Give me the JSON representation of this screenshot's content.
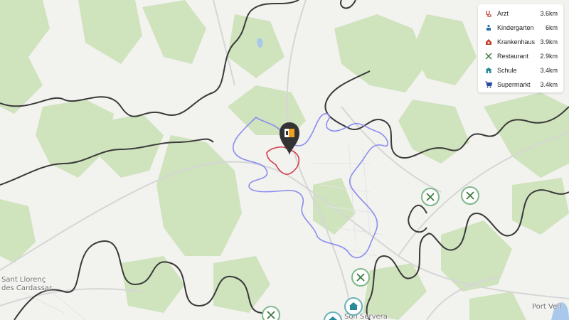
{
  "map": {
    "places": [
      {
        "name": "Sant Llorenç\ndes Cardassar"
      },
      {
        "name": "Son Servera"
      },
      {
        "name": "Port Vell"
      }
    ]
  },
  "legend": {
    "items": [
      {
        "label": "Arzt",
        "distance": "3.6km",
        "icon": "stethoscope-icon",
        "color": "#c0392b"
      },
      {
        "label": "Kindergarten",
        "distance": "6km",
        "icon": "kindergarten-icon",
        "color": "#2f6fa3"
      },
      {
        "label": "Krankenhaus",
        "distance": "3.9km",
        "icon": "hospital-icon",
        "color": "#c0392b"
      },
      {
        "label": "Restaurant",
        "distance": "2.9km",
        "icon": "restaurant-icon",
        "color": "#3d7a3d"
      },
      {
        "label": "Schule",
        "distance": "3.4km",
        "icon": "school-icon",
        "color": "#2a8a9a"
      },
      {
        "label": "Supermarkt",
        "distance": "3.4km",
        "icon": "cart-icon",
        "color": "#2a4a9a"
      }
    ]
  },
  "colors": {
    "forest": "#cfe3bd",
    "isochrone_black": "#3a3a3a",
    "isochrone_blue": "#8c8cf0",
    "isochrone_red": "#d23c4a",
    "pin": "#333333",
    "pin_accent": "#f0a020"
  }
}
